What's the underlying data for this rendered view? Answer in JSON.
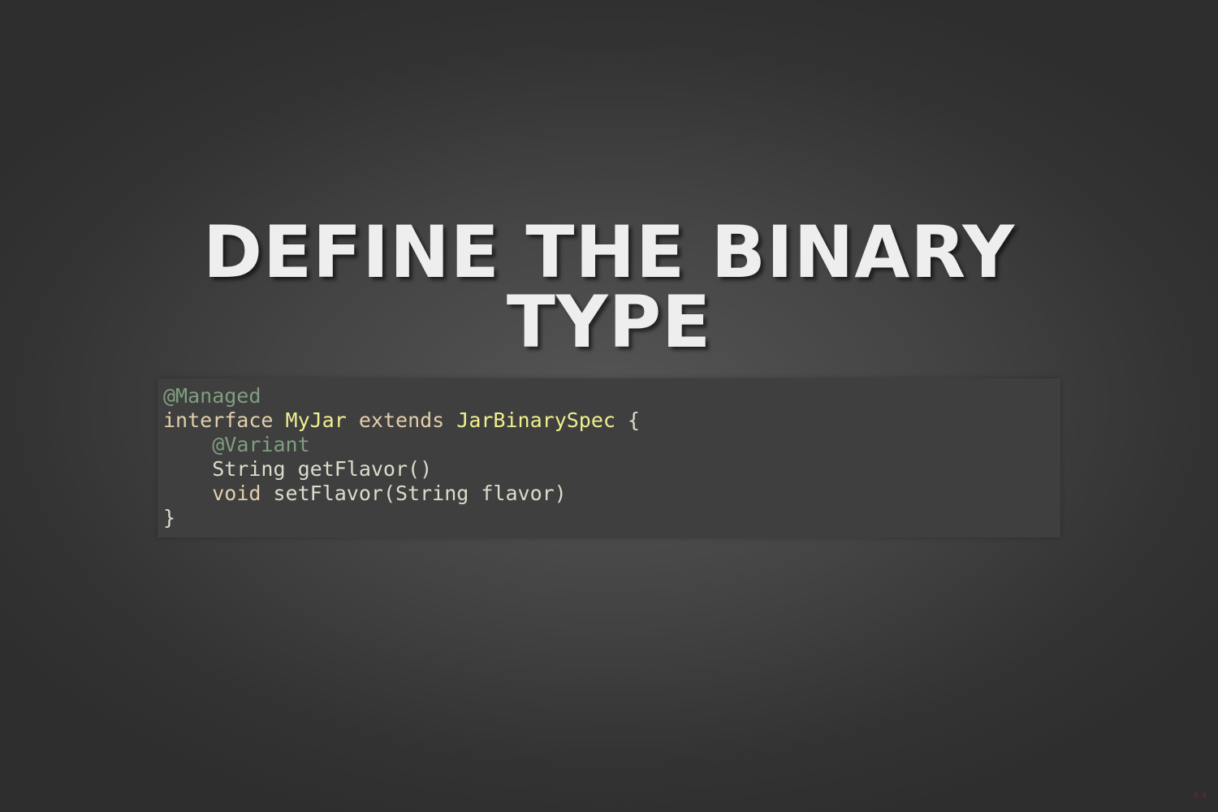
{
  "slide": {
    "title_line1": "DEFINE THE BINARY",
    "title_line2": "TYPE",
    "slide_number": "6.4"
  },
  "code": {
    "language": "java",
    "lines": [
      {
        "tokens": [
          "@Managed"
        ]
      },
      {
        "tokens": [
          "interface",
          " ",
          "MyJar",
          " ",
          "extends",
          " ",
          "JarBinarySpec",
          " {"
        ]
      },
      {
        "tokens": [
          "    ",
          "@Variant"
        ]
      },
      {
        "tokens": [
          "    String getFlavor()"
        ]
      },
      {
        "tokens": [
          "    ",
          "void",
          " setFlavor(String flavor)"
        ]
      },
      {
        "tokens": [
          "}"
        ]
      }
    ]
  },
  "colors": {
    "background": "#444444",
    "title": "#eeeeee",
    "code_background": "#3f3f3f",
    "code_text": "#dcdccc",
    "annotation": "#7f9f7f",
    "keyword": "#e3ceab",
    "class_name": "#efef8f"
  }
}
